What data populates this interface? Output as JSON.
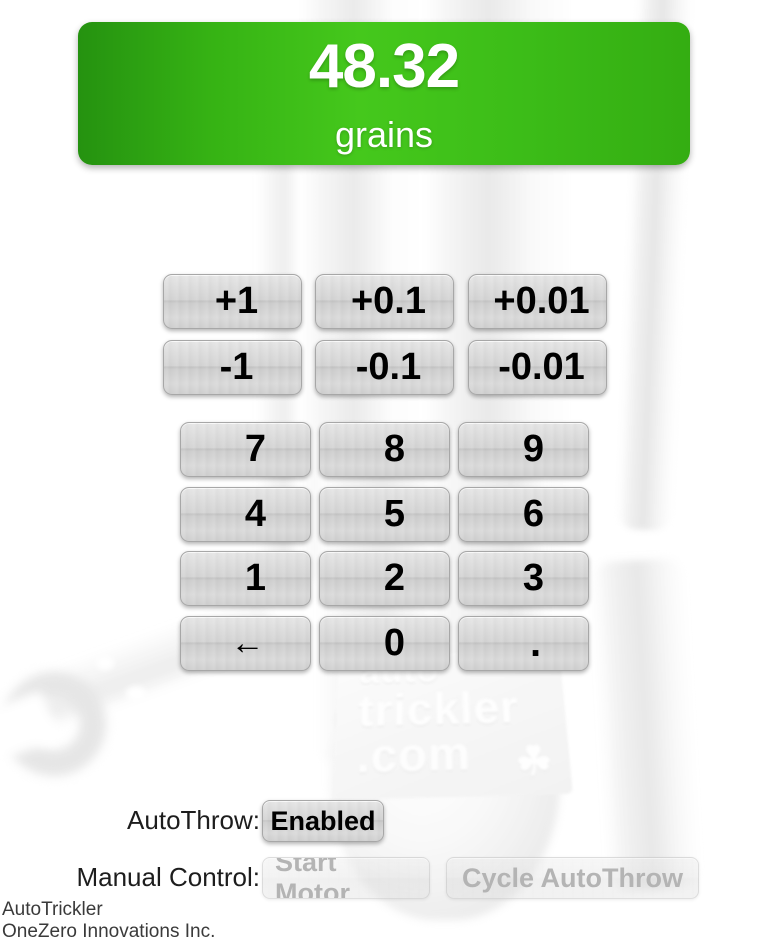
{
  "app": {
    "name": "AutoTrickler",
    "company": "OneZero Innovations Inc."
  },
  "display": {
    "value": "48.32",
    "unit": "grains",
    "accent_color": "#3cbd18"
  },
  "increment_buttons": [
    {
      "label": "+1",
      "name": "increment-1"
    },
    {
      "label": "+0.1",
      "name": "increment-0-1"
    },
    {
      "label": "+0.01",
      "name": "increment-0-01"
    },
    {
      "label": "-1",
      "name": "decrement-1"
    },
    {
      "label": "-0.1",
      "name": "decrement-0-1"
    },
    {
      "label": "-0.01",
      "name": "decrement-0-01"
    }
  ],
  "keypad": [
    {
      "label": "7",
      "name": "key-7"
    },
    {
      "label": "8",
      "name": "key-8"
    },
    {
      "label": "9",
      "name": "key-9"
    },
    {
      "label": "4",
      "name": "key-4"
    },
    {
      "label": "5",
      "name": "key-5"
    },
    {
      "label": "6",
      "name": "key-6"
    },
    {
      "label": "1",
      "name": "key-1"
    },
    {
      "label": "2",
      "name": "key-2"
    },
    {
      "label": "3",
      "name": "key-3"
    },
    {
      "label": "←",
      "name": "key-backspace"
    },
    {
      "label": "0",
      "name": "key-0"
    },
    {
      "label": ".",
      "name": "key-decimal"
    }
  ],
  "autothrow": {
    "label": "AutoThrow:",
    "state_button": "Enabled"
  },
  "manual_control": {
    "label": "Manual Control:",
    "start_motor": "Start Motor",
    "cycle_autothrow": "Cycle AutoThrow"
  },
  "background": {
    "engraving_line1": "auto",
    "engraving_line2": "trickler",
    "engraving_line3": ".com",
    "maple_leaf": "☘"
  }
}
